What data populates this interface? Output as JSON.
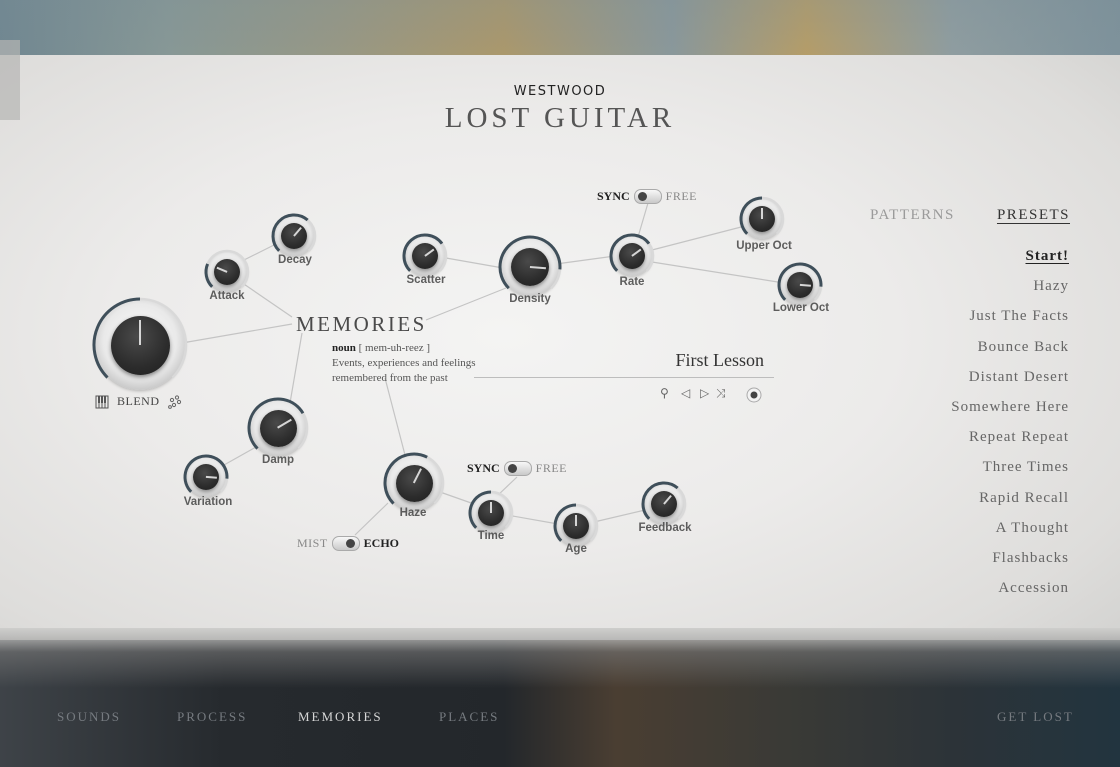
{
  "brand": {
    "maker": "WESTWOOD",
    "product": "LOST GUITAR"
  },
  "page": {
    "title": "MEMORIES",
    "definition": {
      "pos": "noun",
      "pronunciation": "[ mem-uh-reez ]",
      "line1": "Events, experiences and feelings",
      "line2": "remembered from the past"
    }
  },
  "pattern": {
    "name": "First Lesson",
    "controls": [
      {
        "icon": "search-icon",
        "glyph": "⚲"
      },
      {
        "icon": "previous-icon",
        "glyph": "◁"
      },
      {
        "icon": "next-icon",
        "glyph": "▷"
      },
      {
        "icon": "shuffle-icon",
        "glyph": "⤨"
      }
    ]
  },
  "knobs": {
    "blend": {
      "label": "BLEND",
      "value": 0.5
    },
    "attack": {
      "label": "Attack",
      "value": 0.25
    },
    "decay": {
      "label": "Decay",
      "value": 0.65
    },
    "scatter": {
      "label": "Scatter",
      "value": 0.7
    },
    "density": {
      "label": "Density",
      "value": 0.85
    },
    "rate": {
      "label": "Rate",
      "value": 0.7
    },
    "upper_oct": {
      "label": "Upper Oct",
      "value": 0.5
    },
    "lower_oct": {
      "label": "Lower Oct",
      "value": 0.85
    },
    "damp": {
      "label": "Damp",
      "value": 0.72
    },
    "variation": {
      "label": "Variation",
      "value": 0.85
    },
    "haze": {
      "label": "Haze",
      "value": 0.6
    },
    "time": {
      "label": "Time",
      "value": 0.5
    },
    "age": {
      "label": "Age",
      "value": 0.5
    },
    "feedback": {
      "label": "Feedback",
      "value": 0.65
    }
  },
  "toggles": {
    "sync_top": {
      "left": "SYNC",
      "right": "FREE",
      "selected": "SYNC"
    },
    "sync_bottom": {
      "left": "SYNC",
      "right": "FREE",
      "selected": "SYNC"
    },
    "mist_echo": {
      "left": "MIST",
      "right": "ECHO",
      "selected": "ECHO"
    }
  },
  "side_tabs": [
    {
      "label": "PATTERNS",
      "active": false
    },
    {
      "label": "PRESETS",
      "active": true
    }
  ],
  "presets": [
    "Start!",
    "Hazy",
    "Just The Facts",
    "Bounce Back",
    "Distant Desert",
    "Somewhere Here",
    "Repeat Repeat",
    "Three Times",
    "Rapid Recall",
    "A Thought",
    "Flashbacks",
    "Accession"
  ],
  "selected_preset": "Start!",
  "bottom_nav": [
    {
      "label": "SOUNDS",
      "active": false
    },
    {
      "label": "PROCESS",
      "active": false
    },
    {
      "label": "MEMORIES",
      "active": true
    },
    {
      "label": "PLACES",
      "active": false
    },
    {
      "label": "GET LOST",
      "active": false
    }
  ],
  "colors": {
    "arc": "#3f4f5a",
    "knob_cap": "#2c2c2c",
    "paper": "#ecebea"
  }
}
